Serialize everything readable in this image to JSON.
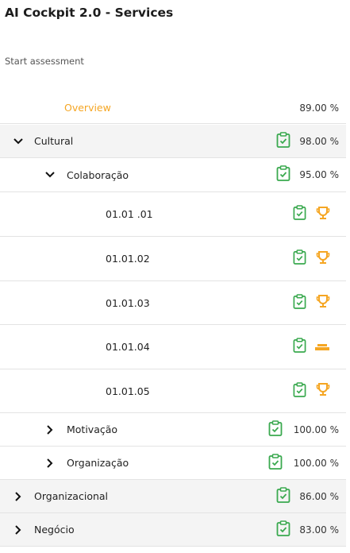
{
  "page": {
    "title": "AI Cockpit 2.0 - Services",
    "start_label": "Start assessment"
  },
  "overview": {
    "label": "Overview",
    "percent": "89.00 %"
  },
  "rows": {
    "cultural": {
      "label": "Cultural",
      "percent": "98.00 %"
    },
    "colaboracao": {
      "label": "Colaboração",
      "percent": "95.00 %"
    },
    "items": [
      {
        "label": "01.01 .01",
        "status_icon": "trophy-icon"
      },
      {
        "label": "01.01.02",
        "status_icon": "trophy-icon"
      },
      {
        "label": "01.01.03",
        "status_icon": "trophy-icon"
      },
      {
        "label": "01.01.04",
        "status_icon": "bar-icon"
      },
      {
        "label": "01.01.05",
        "status_icon": "trophy-icon"
      }
    ],
    "motivacao": {
      "label": "Motivação",
      "percent": "100.00 %"
    },
    "organizacao": {
      "label": "Organização",
      "percent": "100.00 %"
    },
    "organizacional": {
      "label": "Organizacional",
      "percent": "86.00 %"
    },
    "negocio": {
      "label": "Negócio",
      "percent": "83.00 %"
    }
  },
  "colors": {
    "accent": "#f5a623",
    "green": "#3aa94f",
    "row_bg": "#f4f4f4"
  }
}
